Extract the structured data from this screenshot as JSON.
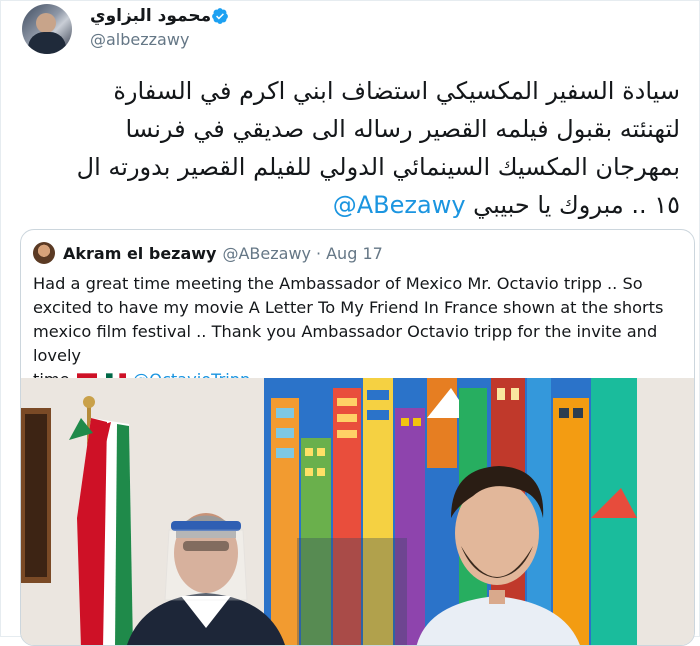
{
  "author": {
    "display_name": "محمود البزاوي",
    "handle": "@albezzawy",
    "verified": true,
    "avatar_icon": "profile-photo"
  },
  "tweet": {
    "lines": [
      "سيادة السفير المكسيكي استضاف ابني اكرم في السفارة",
      "لتهنئته بقبول فيلمه القصير رساله الى صديقي في فرنسا",
      "بمهرجان المكسيك السينمائي الدولي للفيلم القصير بدورته ال"
    ],
    "last_line_text": "١٥ .. مبروك يا حبيبي",
    "mention": "@ABezawy"
  },
  "quote": {
    "name": "Akram el bezawy",
    "handle": "@ABezawy",
    "separator": "·",
    "date": "Aug 17",
    "text_lines": [
      "Had a great time meeting the Ambassador of Mexico Mr. Octavio tripp .. So",
      "excited to have my movie A Letter To My Friend In France shown at the shorts",
      "mexico film festival .. Thank you Ambassador Octavio tripp for the invite and lovely",
      "time"
    ],
    "flags": [
      "egypt-flag-icon",
      "mexico-flag-icon"
    ],
    "mention": "@OctavioTripp"
  },
  "colors": {
    "link": "#1b95e0",
    "text": "#14171a",
    "muted": "#657786",
    "border": "#ccd6dd",
    "verified": "#1da1f2"
  }
}
